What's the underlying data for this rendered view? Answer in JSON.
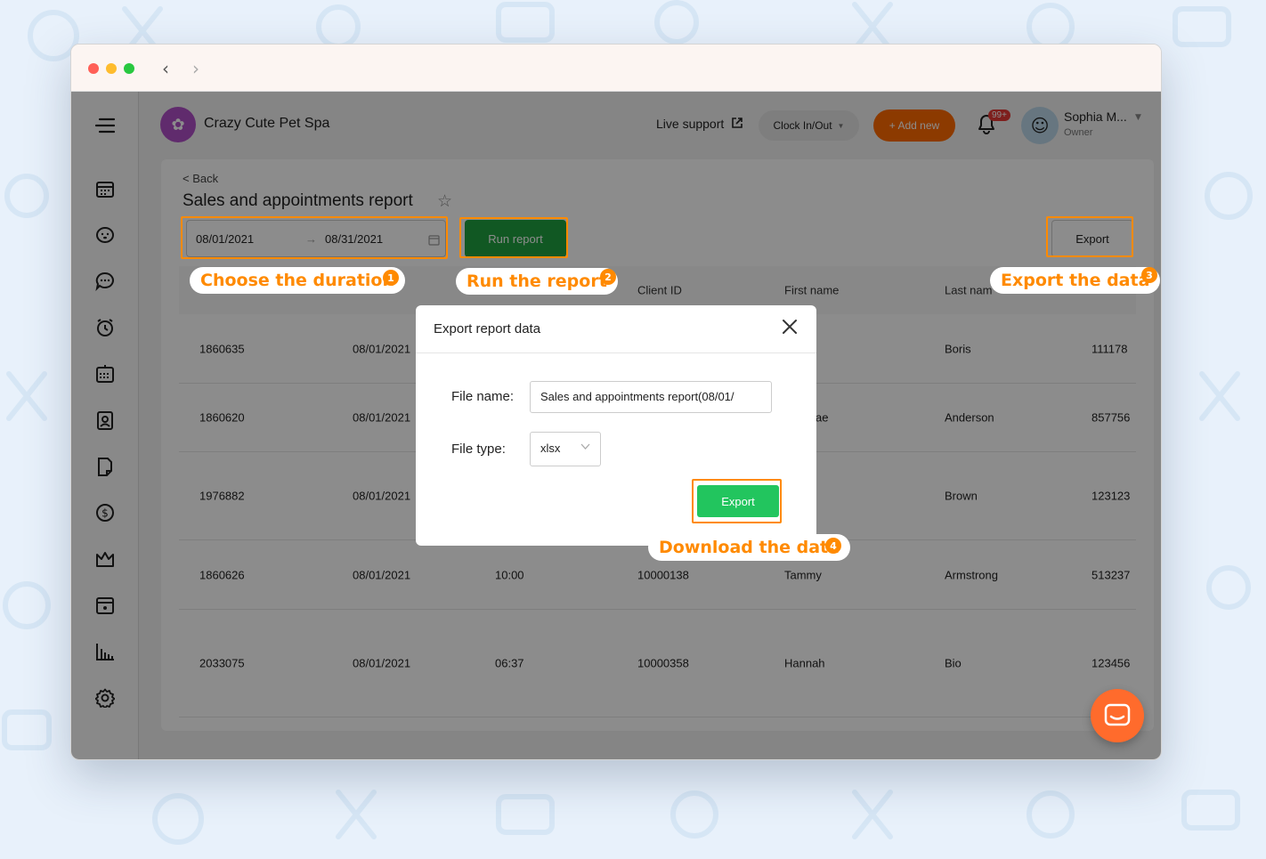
{
  "browser": {
    "back_label": "‹",
    "forward_label": "›"
  },
  "header": {
    "brand": "Crazy Cute Pet Spa",
    "live_support": "Live support",
    "clock_label": "Clock In/Out",
    "add_new": "+ Add new",
    "notif_badge": "99+",
    "user_name": "Sophia M...",
    "user_role": "Owner"
  },
  "sidebar": {
    "icons": [
      "menu-icon",
      "calendar-icon",
      "pet-icon",
      "chat-icon",
      "alarm-icon",
      "schedule-icon",
      "badge-icon",
      "document-icon",
      "dollar-icon",
      "crown-icon",
      "package-icon",
      "chart-icon",
      "settings-icon"
    ]
  },
  "page": {
    "back": "< Back",
    "title": "Sales and appointments report",
    "date_start": "08/01/2021",
    "date_arrow": "→",
    "date_end": "08/31/2021",
    "run_report": "Run report",
    "export": "Export"
  },
  "table": {
    "headers": [
      "Client ID",
      "First name",
      "Last nam"
    ],
    "rows": [
      [
        "1860635",
        "08/01/2021",
        "",
        "",
        "",
        "Boris",
        "111178"
      ],
      [
        "1860620",
        "08/01/2021",
        "",
        "",
        "ae",
        "Anderson",
        "857756"
      ],
      [
        "1976882",
        "08/01/2021",
        "",
        "",
        "",
        "Brown",
        "123123"
      ],
      [
        "1860626",
        "08/01/2021",
        "10:00",
        "10000138",
        "Tammy",
        "Armstrong",
        "513237"
      ],
      [
        "2033075",
        "08/01/2021",
        "06:37",
        "10000358",
        "Hannah",
        "Bio",
        "123456"
      ]
    ]
  },
  "modal": {
    "title": "Export report data",
    "file_name_label": "File name:",
    "file_name_value": "Sales and appointments report(08/01/",
    "file_type_label": "File type:",
    "file_type_value": "xlsx",
    "export_button": "Export"
  },
  "annotations": [
    {
      "text": "Choose the duration",
      "step": "1"
    },
    {
      "text": "Run the report",
      "step": "2"
    },
    {
      "text": "Export the data",
      "step": "3"
    },
    {
      "text": "Download the data",
      "step": "4"
    }
  ],
  "colors": {
    "accent_orange": "#ff8a00",
    "run_green": "#20a040",
    "export_green": "#22c55e",
    "add_new_orange": "#ff6b00"
  }
}
